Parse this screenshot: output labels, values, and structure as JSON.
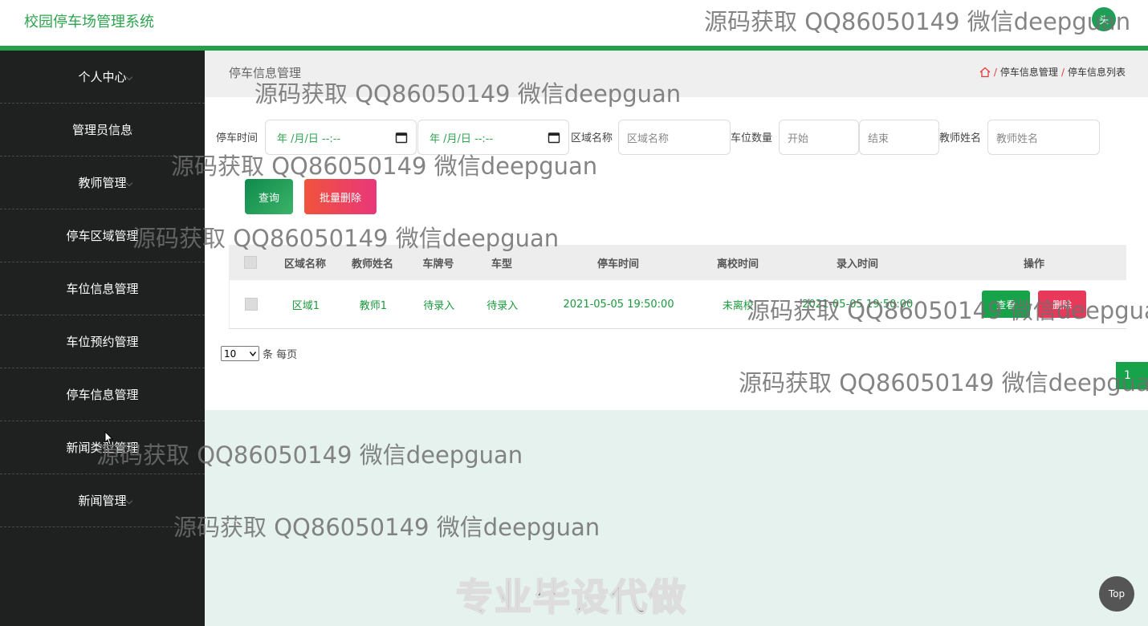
{
  "header": {
    "title": "校园停车场管理系统",
    "avatar_text": "头"
  },
  "sidebar": {
    "items": [
      {
        "label": "个人中心"
      },
      {
        "label": "管理员信息"
      },
      {
        "label": "教师管理"
      },
      {
        "label": "停车区域管理"
      },
      {
        "label": "车位信息管理"
      },
      {
        "label": "车位预约管理"
      },
      {
        "label": "停车信息管理"
      },
      {
        "label": "新闻类型管理"
      },
      {
        "label": "新闻管理"
      }
    ]
  },
  "page": {
    "title": "停车信息管理",
    "breadcrumb": [
      "停车信息管理",
      "停车信息列表"
    ],
    "breadcrumb_sep": "/"
  },
  "search": {
    "parking_time_label": "停车时间",
    "date_placeholder": "年 /月/日 --:--",
    "area_label": "区域名称",
    "area_placeholder": "区域名称",
    "space_count_label": "车位数量",
    "start_placeholder": "开始",
    "end_placeholder": "结束",
    "teacher_label": "教师姓名",
    "teacher_placeholder": "教师姓名",
    "query_button": "查询",
    "batch_delete_button": "批量删除"
  },
  "table": {
    "columns": [
      "区域名称",
      "教师姓名",
      "车牌号",
      "车型",
      "停车时间",
      "离校时间",
      "录入时间",
      "操作"
    ],
    "rows": [
      {
        "area": "区域1",
        "teacher": "教师1",
        "plate": "待录入",
        "model": "待录入",
        "park_time": "2021-05-05 19:50:00",
        "leave_time": "未离校",
        "entry_time": "2021-05-05 19:50:00",
        "view_label": "查看",
        "delete_label": "删除"
      }
    ]
  },
  "pagination": {
    "page_size": "10",
    "per_page_label": "条 每页",
    "current_page": "1"
  },
  "watermark": "源码获取 QQ86050149 微信deepguan",
  "promo": "专业毕设代做",
  "top_button": "Top",
  "colors": {
    "accent": "#26a048",
    "sidebar_bg": "#1f2020",
    "danger": "#e8395a"
  }
}
